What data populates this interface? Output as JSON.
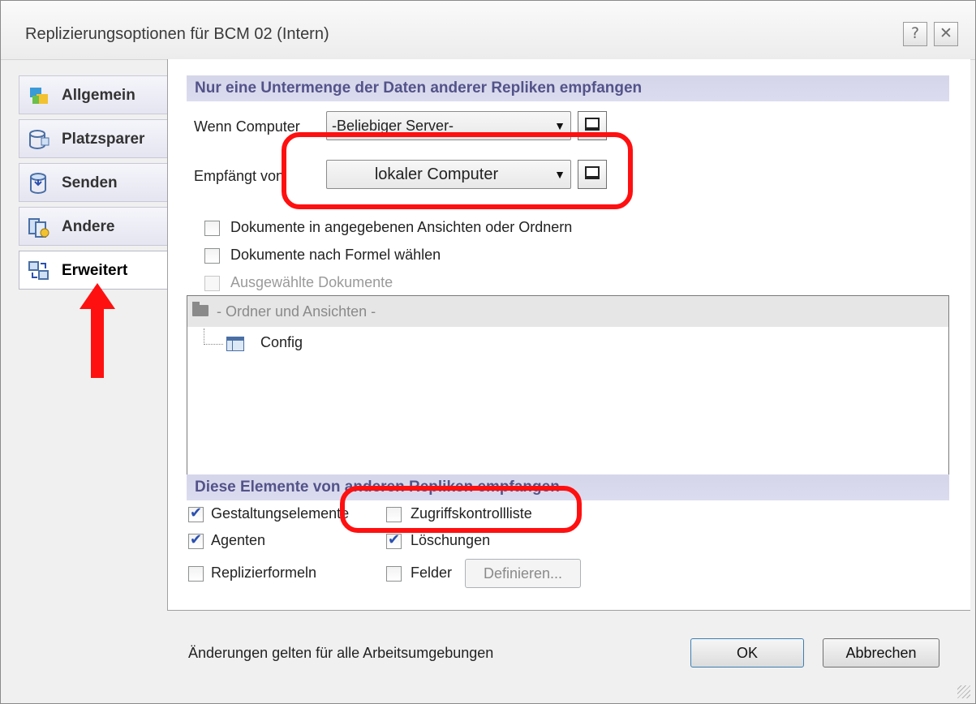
{
  "window": {
    "title": "Replizierungsoptionen für BCM 02 (Intern)",
    "help_label": "?",
    "close_label": "✕"
  },
  "sidebar": {
    "tabs": [
      {
        "label": "Allgemein",
        "icon": "general-icon"
      },
      {
        "label": "Platzsparer",
        "icon": "space-saver-icon"
      },
      {
        "label": "Senden",
        "icon": "send-icon"
      },
      {
        "label": "Andere",
        "icon": "other-icon"
      },
      {
        "label": "Erweitert",
        "icon": "advanced-icon",
        "active": true
      }
    ]
  },
  "subset_section": {
    "header": "Nur eine Untermenge der Daten anderer Repliken empfangen",
    "when_computer_label": "Wenn Computer",
    "when_computer_value": "-Beliebiger Server-",
    "receives_from_label": "Empfängt von",
    "receives_from_value": "lokaler Computer",
    "options": [
      {
        "label": "Dokumente in angegebenen Ansichten oder Ordnern",
        "checked": false,
        "enabled": true
      },
      {
        "label": "Dokumente nach Formel wählen",
        "checked": false,
        "enabled": true
      },
      {
        "label": "Ausgewählte Dokumente",
        "checked": false,
        "enabled": false
      }
    ],
    "tree": {
      "header": "- Ordner und Ansichten -",
      "items": [
        "Config"
      ]
    }
  },
  "elements_section": {
    "header": "Diese Elemente von anderen Repliken empfangen",
    "items": [
      {
        "label": "Gestaltungselemente",
        "checked": true
      },
      {
        "label": "Zugriffskontrollliste",
        "checked": false
      },
      {
        "label": "Agenten",
        "checked": true
      },
      {
        "label": "Löschungen",
        "checked": true
      },
      {
        "label": "Replizierformeln",
        "checked": false
      },
      {
        "label": "Felder",
        "checked": false
      }
    ],
    "define_button": "Definieren..."
  },
  "footer": {
    "status": "Änderungen gelten für alle Arbeitsumgebungen",
    "ok": "OK",
    "cancel": "Abbrechen"
  },
  "annotation_color": "#ff1010",
  "check_mark": "✔"
}
